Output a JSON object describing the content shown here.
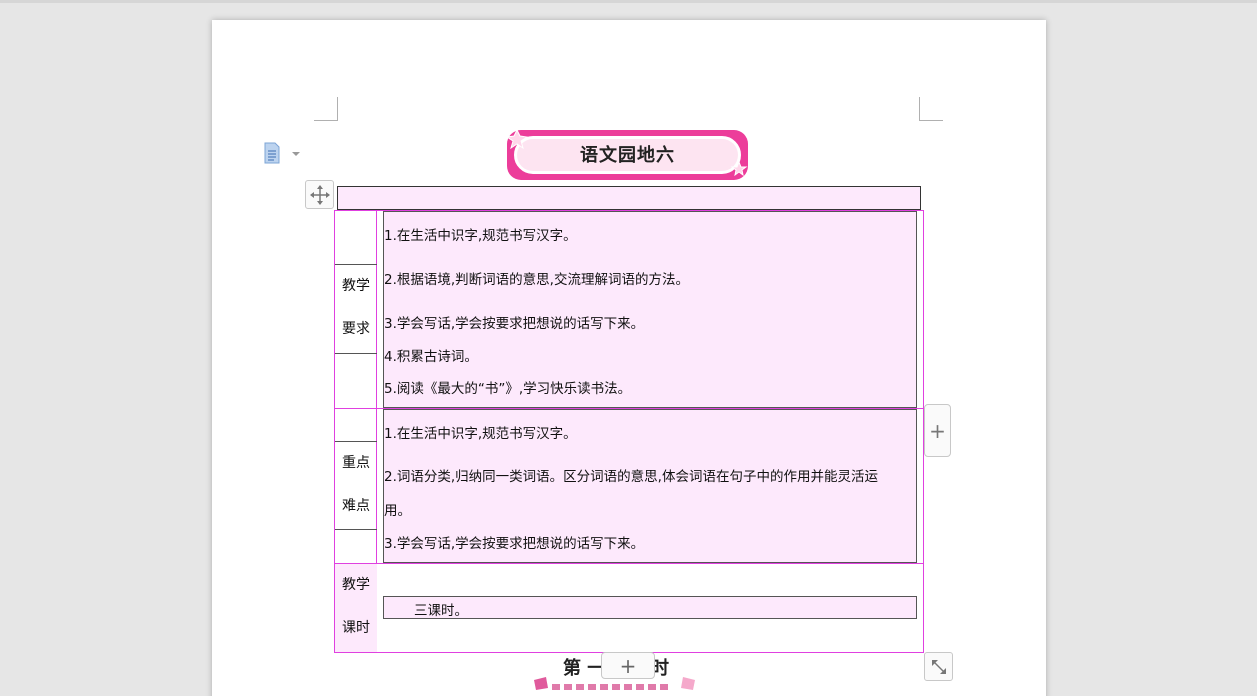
{
  "document": {
    "title": "语文园地六",
    "sections": [
      {
        "label_line1": "教学",
        "label_line2": "要求",
        "items": [
          "1.在生活中识字,规范书写汉字。",
          "2.根据语境,判断词语的意思,交流理解词语的方法。",
          "3.学会写话,学会按要求把想说的话写下来。",
          "4.积累古诗词。",
          "5.阅读《最大的“书”》,学习快乐读书法。"
        ]
      },
      {
        "label_line1": "重点",
        "label_line2": "难点",
        "items": [
          "1.在生活中识字,规范书写汉字。",
          "2.词语分类,归纳同一类词语。区分词语的意思,体会词语在句子中的作用并能灵活运",
          "用。",
          "3.学会写话,学会按要求把想说的话写下来。"
        ]
      },
      {
        "label_line1": "教学",
        "label_line2": "课时",
        "items": [
          "三课时。"
        ]
      }
    ],
    "next_heading_left": "第 一",
    "next_heading_right": "时"
  },
  "controls": {
    "add_row_symbol": "+",
    "add_col_symbol": "+"
  },
  "colors": {
    "cell_fill": "#fde9fc",
    "table_border": "#e040e0",
    "banner_pink": "#ec3d9a"
  }
}
